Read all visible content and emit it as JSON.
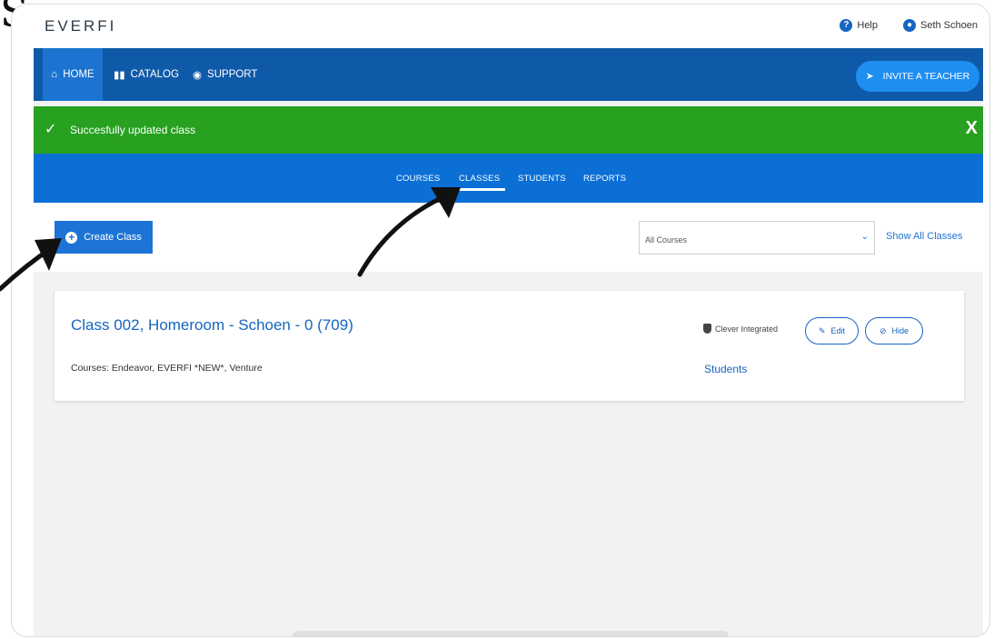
{
  "header": {
    "logo": "EVERFI",
    "help_label": "Help",
    "user_name": "Seth Schoen"
  },
  "main_nav": {
    "items": [
      {
        "label": "HOME",
        "icon": "home-icon"
      },
      {
        "label": "CATALOG",
        "icon": "book-icon"
      },
      {
        "label": "SUPPORT",
        "icon": "globe-icon"
      }
    ],
    "invite_label": "INVITE A TEACHER"
  },
  "banner": {
    "message": "Succesfully updated class",
    "close_glyph": "X"
  },
  "sub_nav": {
    "tabs": [
      "COURSES",
      "CLASSES",
      "STUDENTS",
      "REPORTS"
    ],
    "active": "CLASSES"
  },
  "toolbar": {
    "create_label": "Create Class",
    "filter_value": "All Courses",
    "show_all_label": "Show All Classes"
  },
  "class_card": {
    "title": "Class 002, Homeroom - Schoen - 0 (709)",
    "courses": "Courses: Endeavor, EVERFI *NEW*, Venture",
    "clever_label": "Clever Integrated",
    "students_link": "Students",
    "edit_label": "Edit",
    "hide_label": "Hide"
  },
  "overlay": {
    "stray_glyph": "S"
  },
  "colors": {
    "nav_dark": "#0f5aa8",
    "subnav": "#0b6fd6",
    "success": "#27a11f",
    "accent": "#1d74d6"
  }
}
